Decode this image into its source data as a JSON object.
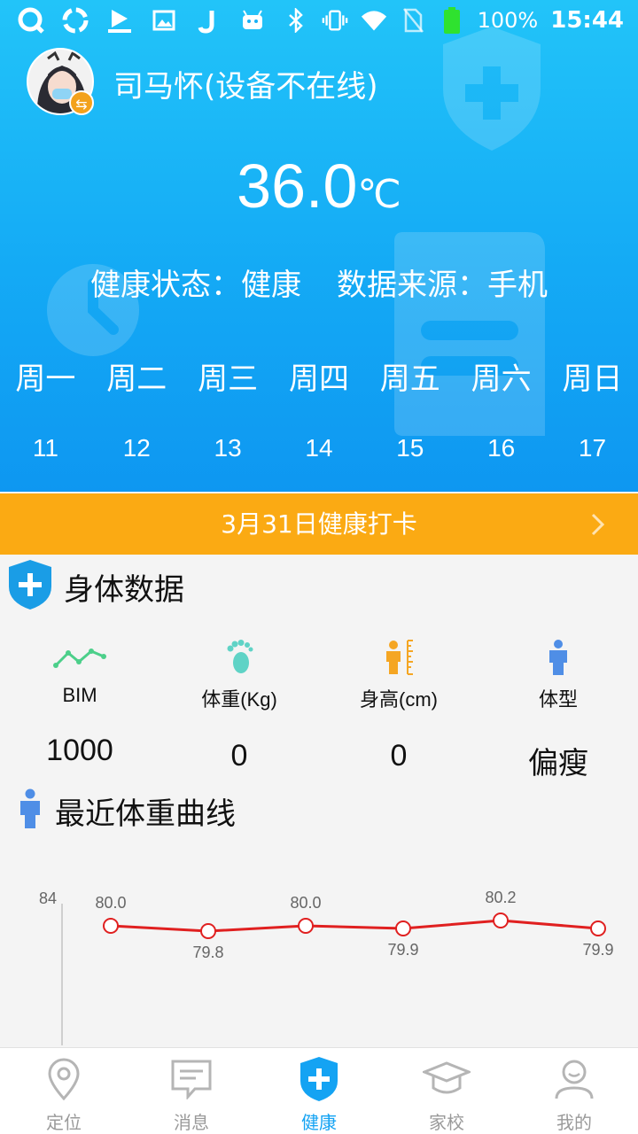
{
  "status_bar": {
    "battery": "100%",
    "time": "15:44",
    "icons": [
      "q-app-icon",
      "sync-app-icon",
      "youku-icon",
      "gallery-icon",
      "j-app-icon",
      "android-icon",
      "bluetooth-icon",
      "vibrate-icon",
      "wifi-icon",
      "no-sim-icon",
      "battery-icon"
    ]
  },
  "profile": {
    "name": "司马怀(设备不在线)"
  },
  "temperature": {
    "value": "36.0",
    "unit": "℃"
  },
  "status": {
    "health": "健康状态：健康",
    "source": "数据来源：手机"
  },
  "week": {
    "days": [
      "周一",
      "周二",
      "周三",
      "周四",
      "周五",
      "周六",
      "周日"
    ],
    "dates": [
      "11",
      "12",
      "13",
      "14",
      "15",
      "16",
      "17"
    ]
  },
  "checkin": {
    "label": "3月31日健康打卡"
  },
  "body_data": {
    "title": "身体数据",
    "metrics": [
      {
        "label": "BIM",
        "value": "1000"
      },
      {
        "label": "体重(Kg)",
        "value": "0"
      },
      {
        "label": "身高(cm)",
        "value": "0"
      },
      {
        "label": "体型",
        "value": "偏瘦"
      }
    ]
  },
  "weight_curve": {
    "title": "最近体重曲线"
  },
  "chart_data": {
    "type": "line",
    "title": "最近体重曲线",
    "y_tick_top": "84",
    "series": [
      {
        "values": [
          80.0,
          79.8,
          80.0,
          79.9,
          80.2,
          79.9
        ]
      }
    ],
    "labels": [
      "80.0",
      "79.8",
      "80.0",
      "79.9",
      "80.2",
      "79.9"
    ],
    "ylim": [
      76,
      84
    ],
    "line_color": "#e02020"
  },
  "nav": {
    "items": [
      {
        "label": "定位",
        "icon": "location-pin-icon"
      },
      {
        "label": "消息",
        "icon": "message-icon"
      },
      {
        "label": "健康",
        "icon": "health-shield-icon"
      },
      {
        "label": "家校",
        "icon": "graduation-cap-icon"
      },
      {
        "label": "我的",
        "icon": "user-icon"
      }
    ],
    "active": "健康"
  },
  "colors": {
    "header_blue": "#14aaf5",
    "checkin_orange": "#fbaa13",
    "active_blue": "#14a3f3",
    "chart_red": "#e02020"
  }
}
